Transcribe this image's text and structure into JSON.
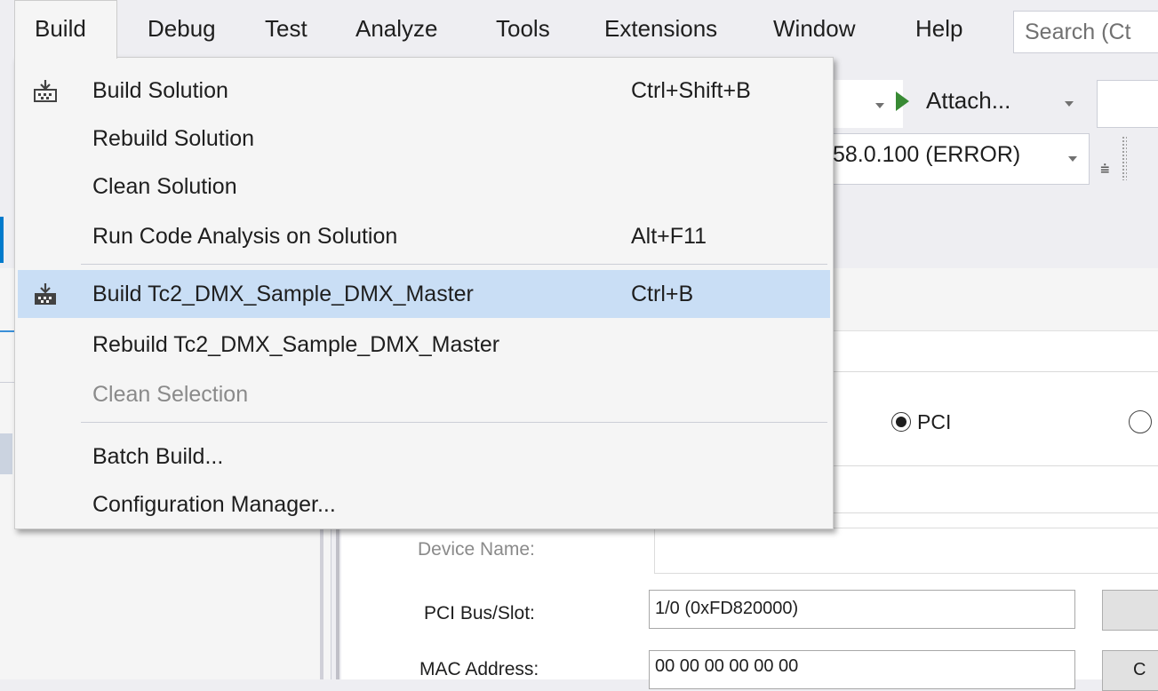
{
  "menubar": {
    "items": [
      "Build",
      "Debug",
      "Test",
      "Analyze",
      "Tools",
      "Extensions",
      "Window",
      "Help"
    ],
    "search_placeholder": "Search (Ct"
  },
  "toolbar": {
    "attach_label": "Attach...",
    "target_combo_value": "58.0.100 (ERROR)"
  },
  "build_menu": {
    "items": [
      {
        "label": "Build Solution",
        "shortcut": "Ctrl+Shift+B",
        "icon": "build-icon",
        "enabled": true,
        "highlighted": false
      },
      {
        "label": "Rebuild Solution",
        "shortcut": "",
        "enabled": true,
        "highlighted": false
      },
      {
        "label": "Clean Solution",
        "shortcut": "",
        "enabled": true,
        "highlighted": false
      },
      {
        "label": "Run Code Analysis on Solution",
        "shortcut": "Alt+F11",
        "enabled": true,
        "highlighted": false
      },
      {
        "label": "Build Tc2_DMX_Sample_DMX_Master",
        "shortcut": "Ctrl+B",
        "icon": "build-icon",
        "enabled": true,
        "highlighted": true
      },
      {
        "label": "Rebuild Tc2_DMX_Sample_DMX_Master",
        "shortcut": "",
        "enabled": true,
        "highlighted": false
      },
      {
        "label": "Clean Selection",
        "shortcut": "",
        "enabled": false,
        "highlighted": false
      },
      {
        "label": "Batch Build...",
        "shortcut": "",
        "enabled": true,
        "highlighted": false
      },
      {
        "label": "Configuration Manager...",
        "shortcut": "",
        "enabled": true,
        "highlighted": false
      }
    ]
  },
  "form": {
    "radio_pci_label": "PCI",
    "device_name_label": "Device Name:",
    "device_name_value": "",
    "pci_label": "PCI Bus/Slot:",
    "pci_value": "1/0 (0xFD820000)",
    "mac_label": "MAC Address:",
    "mac_value": "00 00 00 00 00 00",
    "mac_button_label": "C"
  },
  "colors": {
    "accent": "#007acc",
    "menu_highlight": "#c9def5",
    "play_green": "#388a34"
  }
}
